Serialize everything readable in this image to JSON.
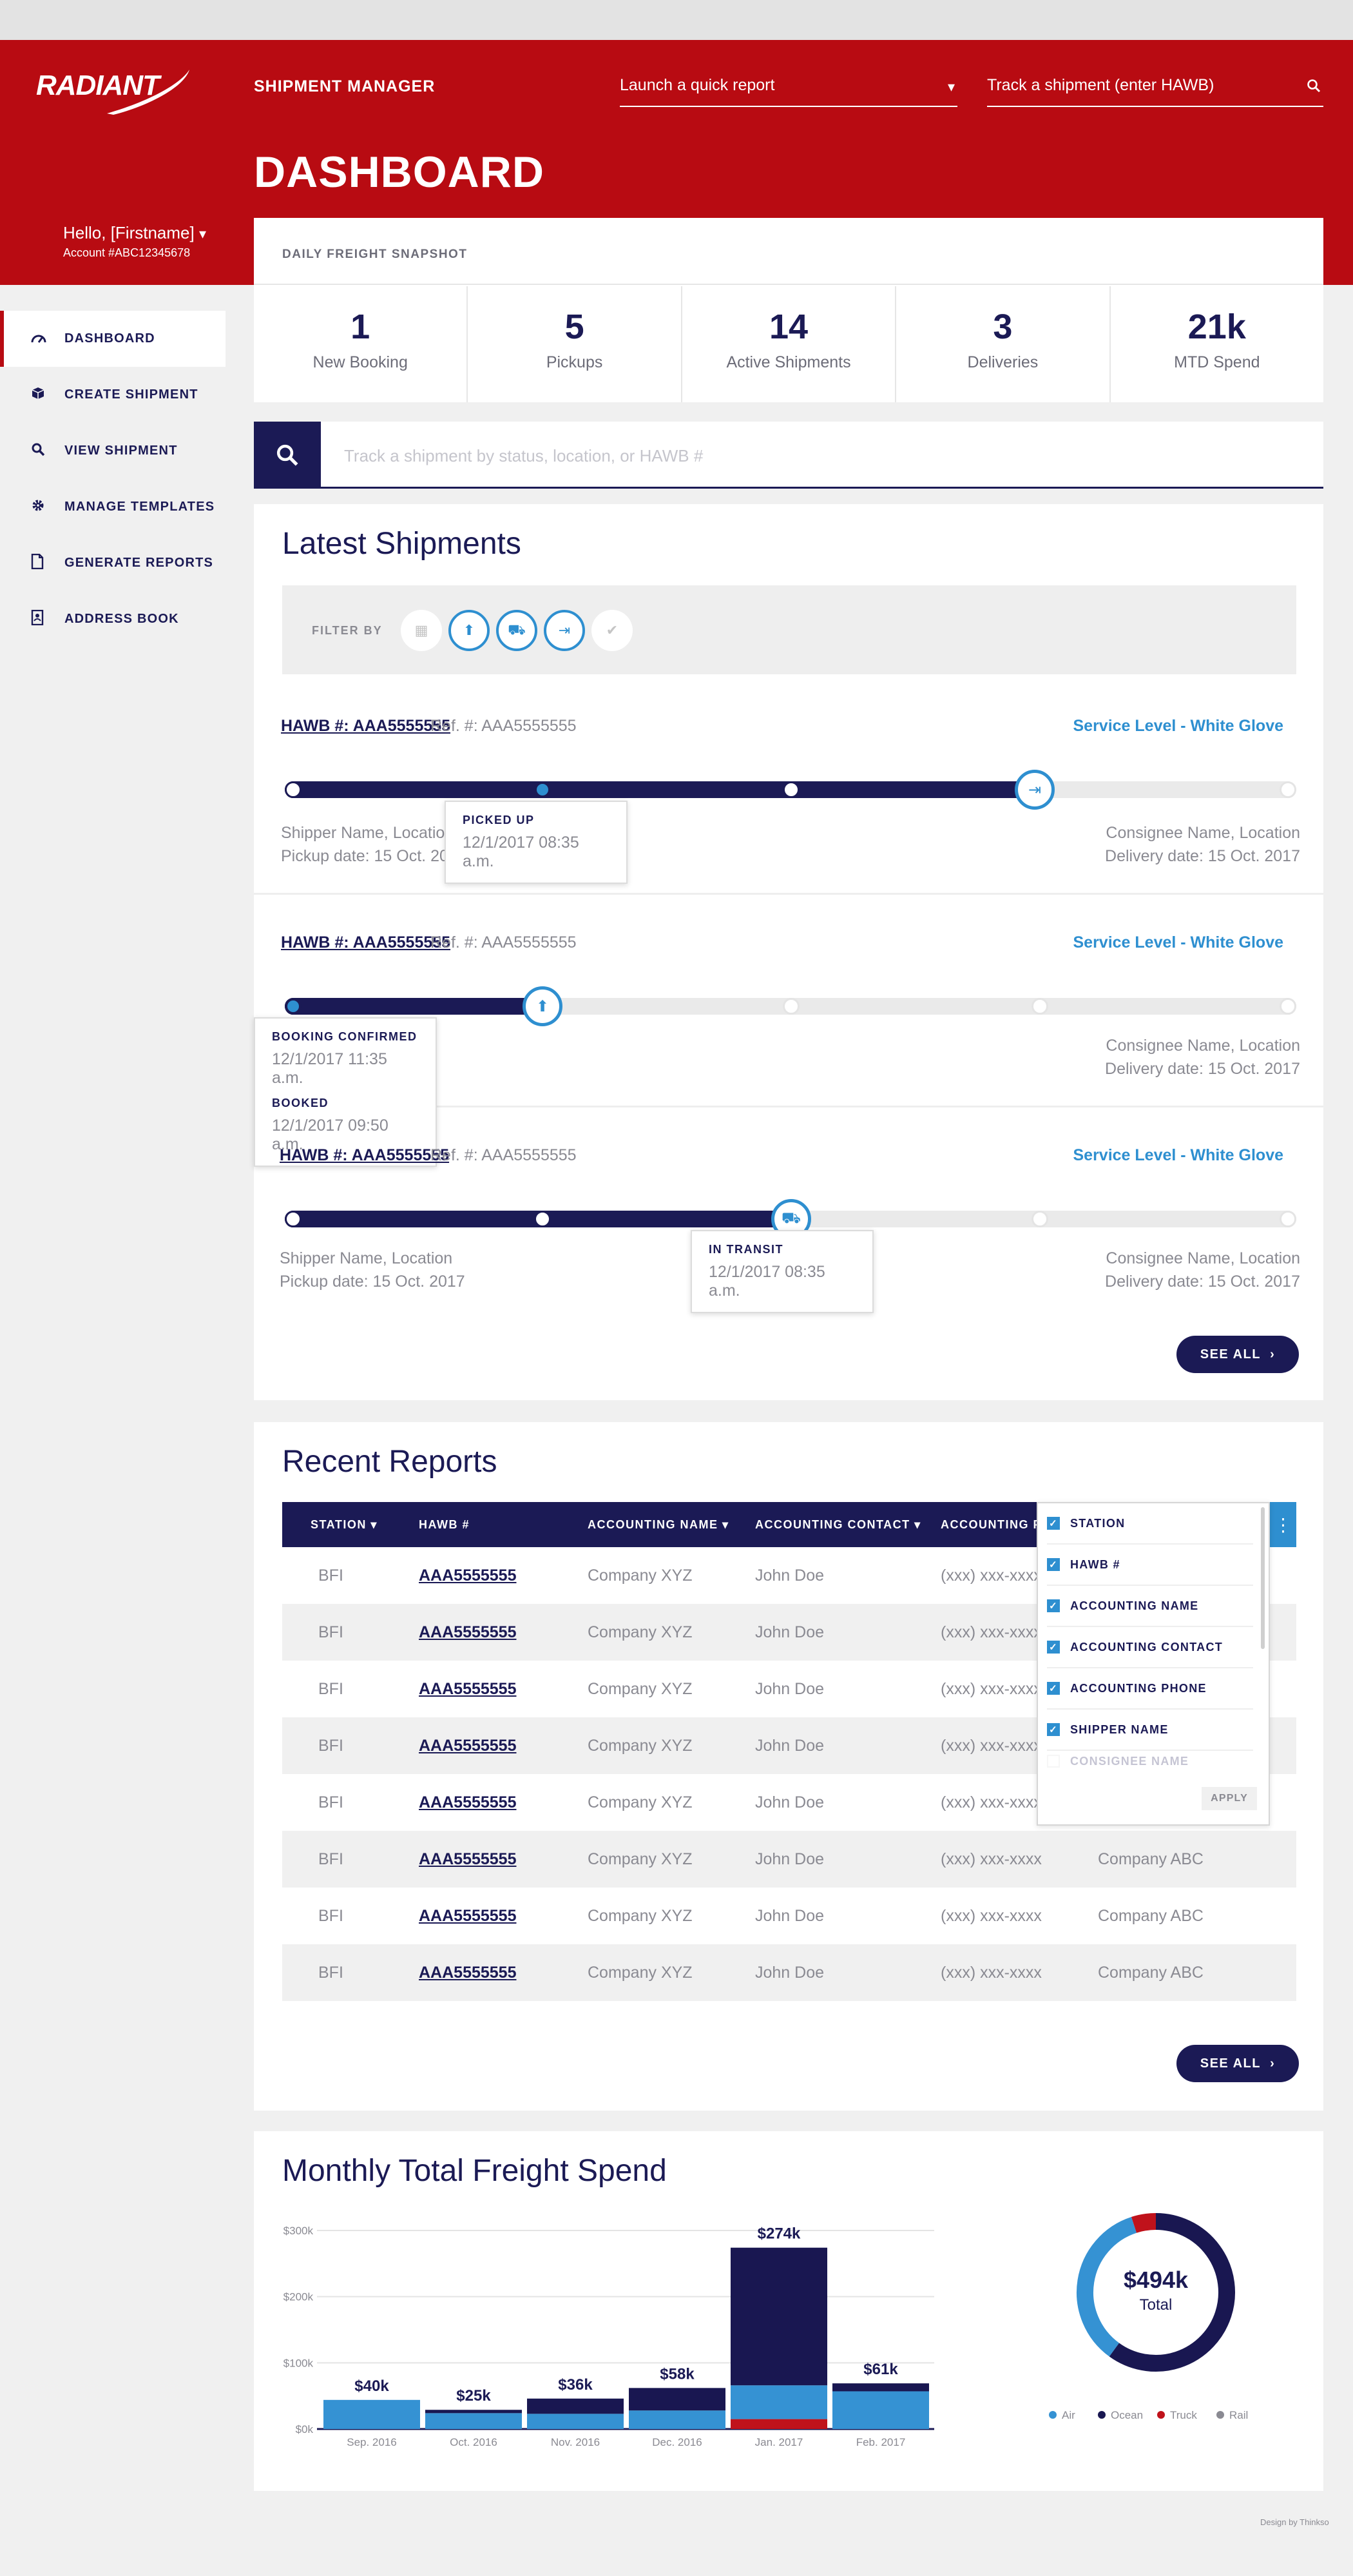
{
  "header": {
    "logo_text": "RADIANT",
    "app_title": "SHIPMENT MANAGER",
    "quick_report_placeholder": "Launch a quick report",
    "track_placeholder": "Track a shipment (enter HAWB)",
    "page_title": "DASHBOARD",
    "greeting": "Hello, [Firstname]",
    "account": "Account #ABC12345678"
  },
  "sidebar": {
    "items": [
      {
        "label": "DASHBOARD",
        "icon": "speedometer-icon"
      },
      {
        "label": "CREATE SHIPMENT",
        "icon": "box-icon"
      },
      {
        "label": "VIEW SHIPMENT",
        "icon": "search-icon"
      },
      {
        "label": "MANAGE TEMPLATES",
        "icon": "gear-icon"
      },
      {
        "label": "GENERATE REPORTS",
        "icon": "document-icon"
      },
      {
        "label": "ADDRESS BOOK",
        "icon": "contact-book-icon"
      }
    ]
  },
  "snapshot": {
    "title": "DAILY FREIGHT SNAPSHOT",
    "stats": [
      {
        "value": "1",
        "label": "New Booking"
      },
      {
        "value": "5",
        "label": "Pickups"
      },
      {
        "value": "14",
        "label": "Active Shipments"
      },
      {
        "value": "3",
        "label": "Deliveries"
      },
      {
        "value": "21k",
        "label": "MTD Spend"
      }
    ]
  },
  "search": {
    "placeholder": "Track a shipment by status, location, or HAWB #"
  },
  "latest": {
    "title": "Latest Shipments",
    "filter_label": "FILTER BY",
    "see_all": "SEE ALL",
    "shipments": [
      {
        "hawb": "HAWB #: AAA5555555",
        "ref": "Ref. #: AAA5555555",
        "service": "Service Level - White Glove",
        "shipper": "Shipper Name, Location",
        "pickup": "Pickup date: 15 Oct. 2017",
        "consignee": "Consignee Name, Location",
        "delivery": "Delivery date: 15 Oct. 2017",
        "progress": 0.75,
        "tips": [
          {
            "title": "PICKED UP",
            "date": "12/1/2017 08:35 a.m."
          }
        ]
      },
      {
        "hawb": "HAWB #: AAA5555555",
        "ref": "Ref. #: AAA5555555",
        "service": "Service Level - White Glove",
        "shipper": "on",
        "pickup": "017",
        "consignee": "Consignee Name, Location",
        "delivery": "Delivery date: 15 Oct. 2017",
        "progress": 0.25,
        "tips": [
          {
            "title": "BOOKING CONFIRMED",
            "date": "12/1/2017 11:35 a.m."
          },
          {
            "title": "BOOKED",
            "date": "12/1/2017 09:50 a.m."
          }
        ]
      },
      {
        "hawb": "HAWB #: AAA5555555",
        "ref": "Ref. #: AAA5555555",
        "service": "Service Level - White Glove",
        "shipper": "Shipper Name, Location",
        "pickup": "Pickup date: 15 Oct. 2017",
        "consignee": "Consignee Name, Location",
        "delivery": "Delivery date: 15 Oct. 2017",
        "progress": 0.5,
        "tips": [
          {
            "title": "IN TRANSIT",
            "date": "12/1/2017 08:35 a.m."
          }
        ]
      }
    ]
  },
  "reports": {
    "title": "Recent Reports",
    "see_all": "SEE ALL",
    "columns": [
      "STATION",
      "HAWB #",
      "ACCOUNTING NAME",
      "ACCOUNTING CONTACT",
      "ACCOUNTING P"
    ],
    "rows": [
      [
        "BFI",
        "AAA5555555",
        "Company XYZ",
        "John Doe",
        "(xxx) xxx-xxxx",
        ""
      ],
      [
        "BFI",
        "AAA5555555",
        "Company XYZ",
        "John Doe",
        "(xxx) xxx-xxxx",
        ""
      ],
      [
        "BFI",
        "AAA5555555",
        "Company XYZ",
        "John Doe",
        "(xxx) xxx-xxxx",
        ""
      ],
      [
        "BFI",
        "AAA5555555",
        "Company XYZ",
        "John Doe",
        "(xxx) xxx-xxxx",
        ""
      ],
      [
        "BFI",
        "AAA5555555",
        "Company XYZ",
        "John Doe",
        "(xxx) xxx-xxxx",
        ""
      ],
      [
        "BFI",
        "AAA5555555",
        "Company XYZ",
        "John Doe",
        "(xxx) xxx-xxxx",
        "Company ABC"
      ],
      [
        "BFI",
        "AAA5555555",
        "Company XYZ",
        "John Doe",
        "(xxx) xxx-xxxx",
        "Company ABC"
      ],
      [
        "BFI",
        "AAA5555555",
        "Company XYZ",
        "John Doe",
        "(xxx) xxx-xxxx",
        "Company ABC"
      ]
    ],
    "column_picker": {
      "options": [
        {
          "label": "STATION",
          "checked": true
        },
        {
          "label": "HAWB #",
          "checked": true
        },
        {
          "label": "ACCOUNTING NAME",
          "checked": true
        },
        {
          "label": "ACCOUNTING CONTACT",
          "checked": true
        },
        {
          "label": "ACCOUNTING PHONE",
          "checked": true
        },
        {
          "label": "SHIPPER NAME",
          "checked": true
        },
        {
          "label": "CONSIGNEE NAME",
          "checked": false
        }
      ],
      "apply": "APPLY"
    }
  },
  "freight": {
    "title": "Monthly Total Freight Spend",
    "donut_value": "$494k",
    "donut_label": "Total"
  },
  "chart_data": [
    {
      "type": "bar",
      "stacked": true,
      "categories": [
        "Sep. 2016",
        "Oct. 2016",
        "Nov. 2016",
        "Dec. 2016",
        "Jan. 2017",
        "Feb. 2017"
      ],
      "y_ticks": [
        "$300k",
        "$200k",
        "$100k",
        "$0k"
      ],
      "ylim": [
        0,
        300
      ],
      "totals_labels": [
        "$40k",
        "$25k",
        "$36k",
        "$58k",
        "$274k",
        "$61k"
      ],
      "series": [
        {
          "name": "Truck",
          "color": "#c0121b",
          "values": [
            0,
            0,
            0,
            0,
            15,
            0
          ]
        },
        {
          "name": "Air",
          "color": "#3592d3",
          "values": [
            44,
            24,
            23,
            28,
            51,
            57
          ]
        },
        {
          "name": "Ocean",
          "color": "#191751",
          "values": [
            0,
            5,
            23,
            34,
            208,
            12
          ]
        },
        {
          "name": "Rail",
          "color": "#8a8a92",
          "values": [
            0,
            0,
            0,
            0,
            0,
            0
          ]
        }
      ],
      "grid": true
    },
    {
      "type": "pie",
      "donut": true,
      "labels": [
        "Air",
        "Ocean",
        "Truck",
        "Rail"
      ],
      "values": [
        35,
        60,
        5,
        0
      ],
      "colors": [
        "#3592d3",
        "#191751",
        "#c0121b",
        "#8a8a92"
      ],
      "legend": "bottom"
    }
  ]
}
